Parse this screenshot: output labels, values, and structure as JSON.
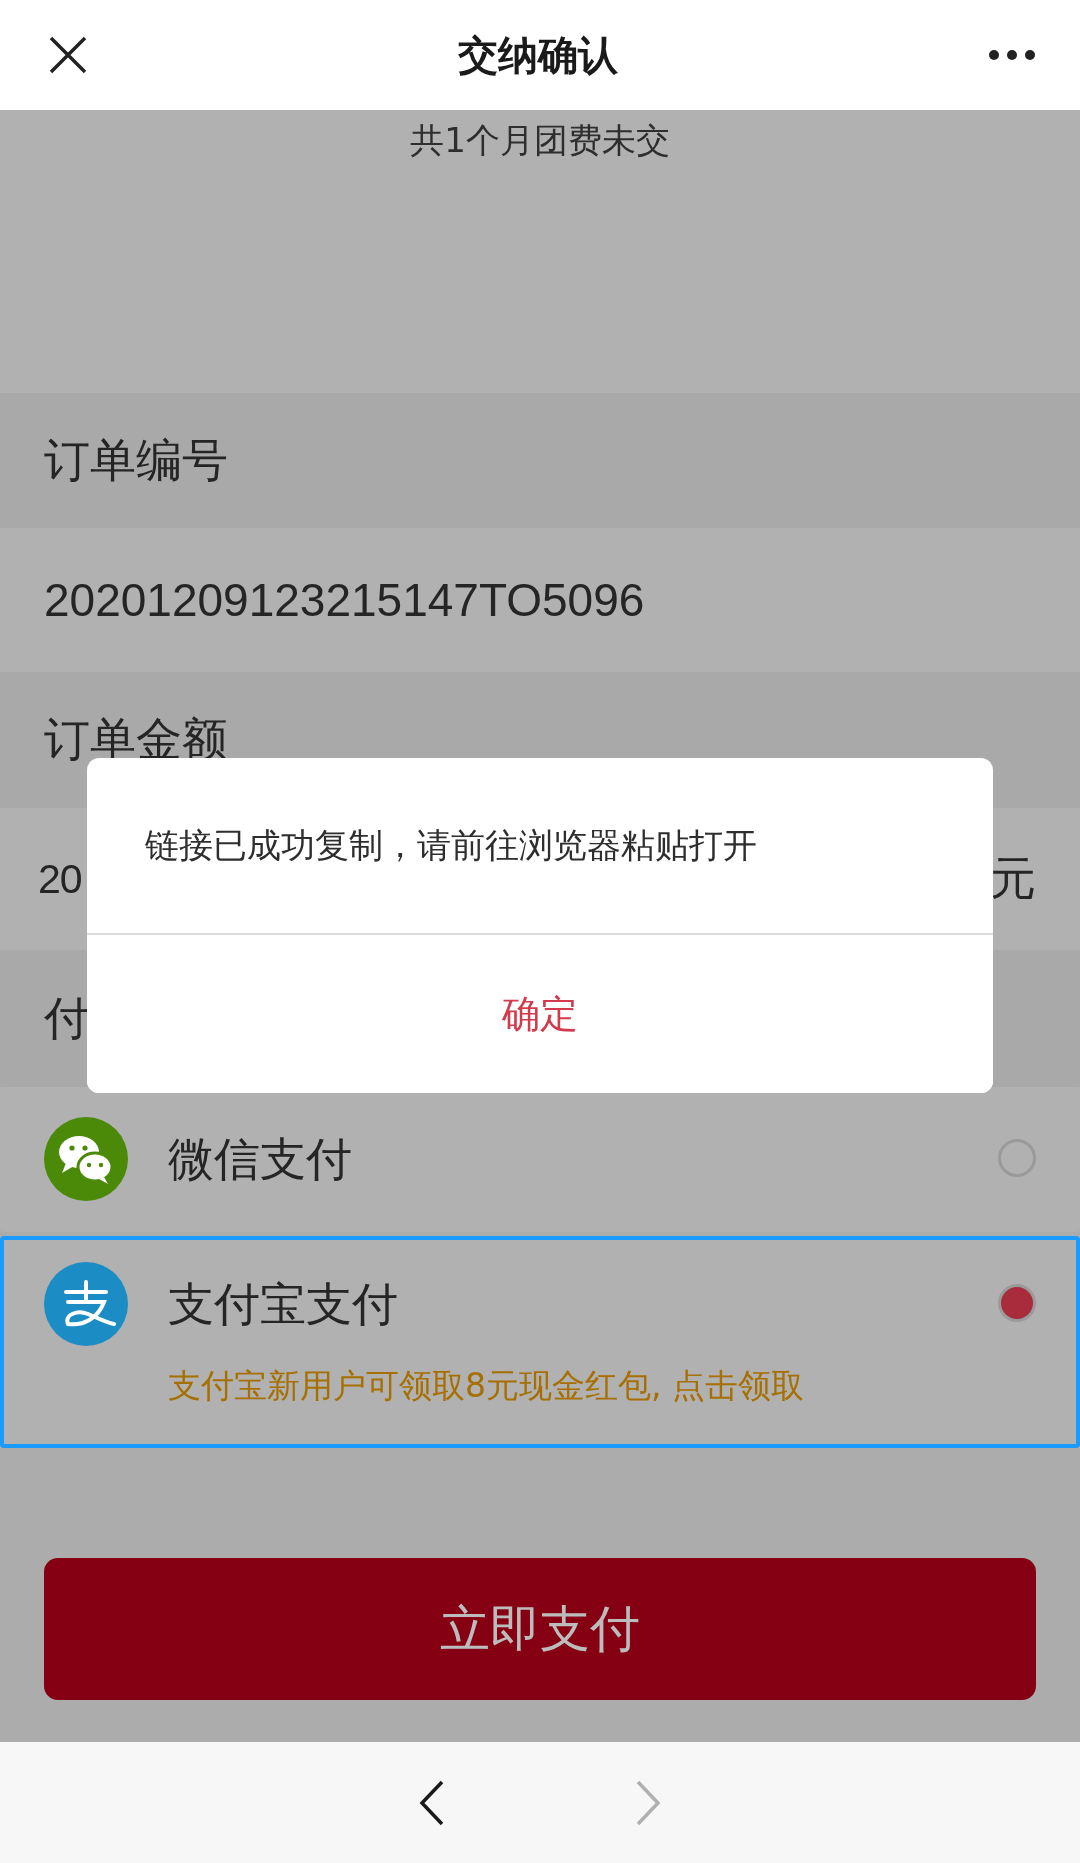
{
  "header": {
    "title": "交纳确认"
  },
  "notice": "共1个月团费未交",
  "order_number": {
    "label": "订单编号",
    "value": "20201209123215147TO5096"
  },
  "order_amount": {
    "label": "订单金额",
    "value_start": "20",
    "value_end": "元"
  },
  "payment_label": "付",
  "payment_methods": [
    {
      "kind": "wechat",
      "name": "微信支付",
      "selected": false,
      "focused": false
    },
    {
      "kind": "alipay",
      "name": "支付宝支付",
      "promo": "支付宝新用户可领取8元现金红包, 点击领取",
      "selected": true,
      "focused": true
    }
  ],
  "pay_button": "立即支付",
  "dialog": {
    "message": "链接已成功复制，请前往浏览器粘贴打开",
    "confirm": "确定"
  },
  "nav": {
    "back_disabled": false,
    "forward_disabled": true
  }
}
